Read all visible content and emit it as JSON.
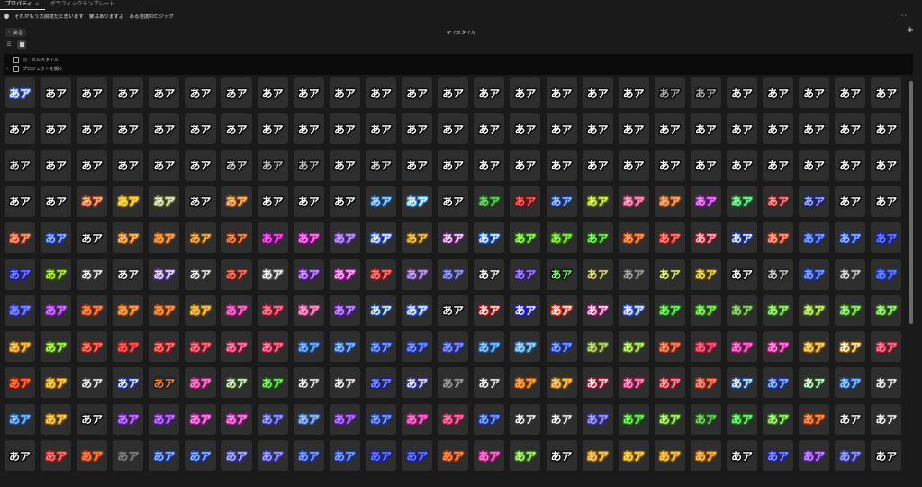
{
  "tabs": [
    {
      "label": "プロパティ",
      "active": true
    },
    {
      "label": "グラフィックテンプレート",
      "active": false
    }
  ],
  "breadcrumb": [
    "それがもう大前提だと思います",
    "要はありますよ",
    "ある程度のロジック"
  ],
  "more_glyph": "···",
  "back_label": "戻る",
  "panel_title": "マイスタイル",
  "add_glyph": "+",
  "sections": [
    {
      "label": "ローカルスタイル"
    },
    {
      "label": "プロジェクトを開く"
    }
  ],
  "tile_sample_text": "あア",
  "tile_fills": [
    [
      "#ffffff",
      "#ffffff",
      "#ffffff",
      "#ffffff",
      "#ffffff",
      "#ffffff",
      "#ffffff",
      "#ffffff",
      "#ffffff",
      "#ffffff",
      "#ffffff",
      "#ffffff",
      "#ffffff",
      "#ffffff",
      "#ffffff",
      "#ffffff",
      "#ffffff",
      "#ffffff",
      "#aaaaaa",
      "#aaaaaa",
      "#ffffff",
      "#ffffff",
      "#ffffff",
      "#ffffff",
      "#ffffff"
    ],
    [
      "#ffffff",
      "#ffffff",
      "#ffffff",
      "#ffffff",
      "#ffffff",
      "#ffffff",
      "#ffffff",
      "#ffffff",
      "#ffffff",
      "#ffffff",
      "#ffffff",
      "#ffffff",
      "#ffffff",
      "#ffffff",
      "#ffffff",
      "#ffffff",
      "#ffffff",
      "#ffffff",
      "#ffffff",
      "#ffffff",
      "#ffffff",
      "#ffffff",
      "#ffffff",
      "#ffffff",
      "#ffffff"
    ],
    [
      "#dddddd",
      "#ffffff",
      "#ffffff",
      "#ffffff",
      "#ffffff",
      "#ffffff",
      "#dddddd",
      "#bbbbbb",
      "#bbbbbb",
      "#ffffff",
      "#dddddd",
      "#ffffff",
      "#ffffff",
      "#ffffff",
      "#ffffff",
      "#ffffff",
      "#ffffff",
      "#ffffff",
      "#ffffff",
      "#ffffff",
      "#ffffff",
      "#ffffff",
      "#ffffff",
      "#ffffff",
      "#ffffff"
    ],
    [
      "#ffffff",
      "#ffffff",
      "#ffd27a",
      "#ffe066",
      "#fffbe0",
      "#ffffff",
      "#ffcc88",
      "#ffffff",
      "#ffffff",
      "#ffffff",
      "#aee8ff",
      "#ffffff",
      "#ffffff",
      "#7bdc6a",
      "#ff6b6b",
      "#9ecbff",
      "#e6ff66",
      "#ffb0cf",
      "#ffb67a",
      "#ff8ff0",
      "#8fffa0",
      "#ff9e9e",
      "#a0b8ff",
      "#ffffff",
      "#ffffff"
    ],
    [
      "#ffb38a",
      "#9ec4ff",
      "#ffffff",
      "#ffd09a",
      "#ffb36b",
      "#ffc870",
      "#ffa070",
      "#ff6bd6",
      "#ff9ee6",
      "#c9a8ff",
      "#ffffff",
      "#ffd36b",
      "#ffffff",
      "#ffffff",
      "#b6ff6b",
      "#8cff6b",
      "#8cff6b",
      "#ffb07a",
      "#ff9a8a",
      "#ffd0d0",
      "#ffffff",
      "#ffb0a0",
      "#8ab0ff",
      "#9ec8ff",
      "#6b8aff"
    ],
    [
      "#7a8cff",
      "#c8ff3a",
      "#ffffff",
      "#ffffff",
      "#ffffff",
      "#ffffff",
      "#ff8a6b",
      "#ffffff",
      "#d2a8ff",
      "#ffd0ff",
      "#ff8a8a",
      "#c8b0ff",
      "#9ea8ff",
      "#ffffff",
      "#a88aff",
      "#6bff6b",
      "#e6e090",
      "#a8a8a8",
      "#e6ff8a",
      "#ffe066",
      "#ffffff",
      "#d0d0d0",
      "#8aa8ff",
      "#dddddd",
      "#6b8aff"
    ],
    [
      "#8a9eff",
      "#d68aff",
      "#ff9a6b",
      "#ffb36b",
      "#ffaa6b",
      "#ffd06b",
      "#ff8ad6",
      "#ff8aa0",
      "#ffb0d0",
      "#c8a8ff",
      "#ffffff",
      "#ffffff",
      "#ffffff",
      "#ffffff",
      "#ffffff",
      "#ffffff",
      "#ffffff",
      "#ffffff",
      "#8aff6b",
      "#8aff6b",
      "#9ee08a",
      "#a8ff8a",
      "#c8ff8a",
      "#a8ff8a",
      "#b0ff8a"
    ],
    [
      "#ffd06b",
      "#c8ff6b",
      "#ff8a6b",
      "#ff6b6b",
      "#ff8a8a",
      "#ff8a8a",
      "#ff9ab0",
      "#ff8aa8",
      "#8ac0ff",
      "#9ec8ff",
      "#8ab0ff",
      "#8aa0ff",
      "#8aa8ff",
      "#a0c8ff",
      "#b0d8ff",
      "#8ab0ff",
      "#c8e08a",
      "#d0ff8a",
      "#ff9a6b",
      "#ff6b8a",
      "#ff8ad0",
      "#ff9ae0",
      "#ffe08a",
      "#ffffff",
      "#ff8aa0"
    ],
    [
      "#ff8a3a",
      "#ffe06b",
      "#ffffff",
      "#ffffff",
      "#ff8a3a",
      "#ff9ad0",
      "#ffffff",
      "#8aff6b",
      "#ffffff",
      "#ffffff",
      "#8aa0ff",
      "#ffffff",
      "#a8a8a8",
      "#ffffff",
      "#ffb06b",
      "#ffd08a",
      "#ffffff",
      "#ffb0d0",
      "#ffb0b0",
      "#ff9a8a",
      "#ffffff",
      "#9ec8ff",
      "#ffffff",
      "#a8d0ff",
      "#ffffff"
    ],
    [
      "#9ec8ff",
      "#ffe06b",
      "#ffffff",
      "#d08aff",
      "#d08aff",
      "#ffa0e0",
      "#ffa0e0",
      "#a0b0ff",
      "#a8c8ff",
      "#c08aff",
      "#8ab0ff",
      "#ff8ad6",
      "#ff8ab0",
      "#8ab0ff",
      "#ffffff",
      "#ffffff",
      "#b0a8ff",
      "#8aff6b",
      "#d0ff8a",
      "#8ad06b",
      "#8aff8a",
      "#b0ff8a",
      "#ffa06b",
      "#ffffff",
      "#ffffff"
    ],
    [
      "#ffffff",
      "#ff8a8a",
      "#ff8a6b",
      "#8a8a8a",
      "#9ec8ff",
      "#9ec8ff",
      "#c8c8ff",
      "#b0b0ff",
      "#8ab0ff",
      "#8ab0ff",
      "#6b8aff",
      "#6b8aff",
      "#ffa06b",
      "#ff8ad6",
      "#c8ff8a",
      "#ffffff",
      "#ffd08a",
      "#ffe06b",
      "#ffd06b",
      "#ffd06b",
      "#ffffff",
      "#8aa0ff",
      "#c8a0ff",
      "#a0b0ff",
      "#ffffff"
    ]
  ],
  "tile_outlines": [
    [
      "#3a66ff",
      "#000000",
      "#000000",
      "#000000",
      "#000000",
      "#000000",
      "#000000",
      "#000000",
      "#000000",
      "#000000",
      "#000000",
      "#000000",
      "#000000",
      "#000000",
      "#000000",
      "#000000",
      "#000000",
      "#000000",
      "#000000",
      "#000000",
      "#000000",
      "#000000",
      "#000000",
      "#000000",
      "#000000"
    ],
    [
      "#000000",
      "#000000",
      "#000000",
      "#000000",
      "#000000",
      "#000000",
      "#000000",
      "#000000",
      "#000000",
      "#000000",
      "#000000",
      "#000000",
      "#000000",
      "#000000",
      "#000000",
      "#000000",
      "#000000",
      "#000000",
      "#000000",
      "#000000",
      "#000000",
      "#000000",
      "#000000",
      "#000000",
      "#000000"
    ],
    [
      "#000000",
      "#000000",
      "#000000",
      "#000000",
      "#000000",
      "#000000",
      "#000000",
      "#000000",
      "#000000",
      "#000000",
      "#000000",
      "#000000",
      "#000000",
      "#000000",
      "#000000",
      "#000000",
      "#000000",
      "#000000",
      "#000000",
      "#000000",
      "#000000",
      "#000000",
      "#000000",
      "#000000",
      "#000000"
    ],
    [
      "#000000",
      "#000000",
      "#c0392b",
      "#d4a000",
      "#6b8a3a",
      "#000000",
      "#c05a1a",
      "#000000",
      "#000000",
      "#000000",
      "#1a5ac0",
      "#3aa0ff",
      "#000000",
      "#1a6b1a",
      "#8a0000",
      "#1a3aa0",
      "#6b8a00",
      "#c03a6b",
      "#c05a1a",
      "#8a1ab0",
      "#1a8a3a",
      "#8a1a1a",
      "#1a1a8a",
      "#000000",
      "#000000"
    ],
    [
      "#c03a1a",
      "#1a3ac0",
      "#000000",
      "#c05a00",
      "#c05a00",
      "#8a4a00",
      "#8a2a00",
      "#8a00a0",
      "#c000c0",
      "#6a3ac0",
      "#3a6aff",
      "#8a5a00",
      "#8a1aa0",
      "#1a6aff",
      "#1a8a00",
      "#3a8a00",
      "#1a6a00",
      "#c03a00",
      "#c01a1a",
      "#c01a3a",
      "#1a3ac0",
      "#c03a1a",
      "#1a3ac0",
      "#1a3ac0",
      "#1a1ac0"
    ],
    [
      "#1a1ac0",
      "#3a6a00",
      "#3a3a3a",
      "#1a1a1a",
      "#6a3ac0",
      "#3a3a3a",
      "#8a1a1a",
      "#6a6a6a",
      "#6a1ac0",
      "#c01ac0",
      "#c01a1a",
      "#6a3a8a",
      "#3a3a8a",
      "#1a1a1a",
      "#3a1a8a",
      "#000000",
      "#3a3a1a",
      "#3a3a3a",
      "#3a3a1a",
      "#6a5a00",
      "#000000",
      "#1a1a1a",
      "#1a3ac0",
      "#3a3a3a",
      "#1a3ac0"
    ],
    [
      "#3a3aff",
      "#8a1ac0",
      "#c03a00",
      "#c05a00",
      "#c04a00",
      "#c07a00",
      "#c01a8a",
      "#c01a3a",
      "#c03a8a",
      "#6a1ac0",
      "#1a5ac0",
      "#3a6aff",
      "#000000",
      "#c01a1a",
      "#1a1aff",
      "#ff3a1a",
      "#c01a8a",
      "#3a6aff",
      "#1a8a1a",
      "#3a8a1a",
      "#3a6a1a",
      "#3a8a1a",
      "#6a8a1a",
      "#3a8a1a",
      "#3a8a1a"
    ],
    [
      "#c07a00",
      "#3a8a00",
      "#c01a1a",
      "#c01a1a",
      "#c01a1a",
      "#c01a3a",
      "#c01a5a",
      "#c01a3a",
      "#1a5ac0",
      "#1a5ac0",
      "#1a3ac0",
      "#1a3ac0",
      "#3a3ac0",
      "#1a6ac0",
      "#3a8ac0",
      "#1a3ac0",
      "#5a7a1a",
      "#5a8a1a",
      "#c03a1a",
      "#c01a3a",
      "#c01a8a",
      "#c01a8a",
      "#c07a00",
      "#c07a00",
      "#c01a3a"
    ],
    [
      "#c01a00",
      "#c07a00",
      "#3a3a3a",
      "#1a3ac0",
      "#1a1a1a",
      "#c01a8a",
      "#3a6a1a",
      "#1a6a1a",
      "#3a3a3a",
      "#3a3a3a",
      "#1a1aa0",
      "#3a3ac0",
      "#3a3a3a",
      "#3a3a3a",
      "#c05a00",
      "#c07a00",
      "#c01a3a",
      "#c01a5a",
      "#c01a3a",
      "#c03a1a",
      "#1a5ac0",
      "#1a3ac0",
      "#1a6a1a",
      "#1a5ac0",
      "#3a3a3a"
    ],
    [
      "#1a5ac0",
      "#c07a00",
      "#000000",
      "#6a1ac0",
      "#6a1ac0",
      "#c01ab0",
      "#c01ab0",
      "#3a3ac0",
      "#3a6ac0",
      "#6a1ac0",
      "#1a3ac0",
      "#c01a8a",
      "#c01a5a",
      "#1a3ac0",
      "#3a3a3a",
      "#3a3a3a",
      "#3a3ac0",
      "#1a8a1a",
      "#3a8a1a",
      "#1a6a1a",
      "#1a8a1a",
      "#3a8a1a",
      "#c03a00",
      "#1a1a1a",
      "#3a3a3a"
    ],
    [
      "#000000",
      "#c01a1a",
      "#c03a00",
      "#3a3a3a",
      "#1a3ac0",
      "#1a3ac0",
      "#3a3ac0",
      "#3a3ac0",
      "#1a3ac0",
      "#1a3ac0",
      "#1a1ac0",
      "#1a1ac0",
      "#c03a00",
      "#c01a8a",
      "#3a8a1a",
      "#000000",
      "#c07a00",
      "#c07a00",
      "#c07a00",
      "#c05a00",
      "#000000",
      "#1a1ac0",
      "#6a1ac0",
      "#3a3ac0",
      "#000000"
    ]
  ]
}
